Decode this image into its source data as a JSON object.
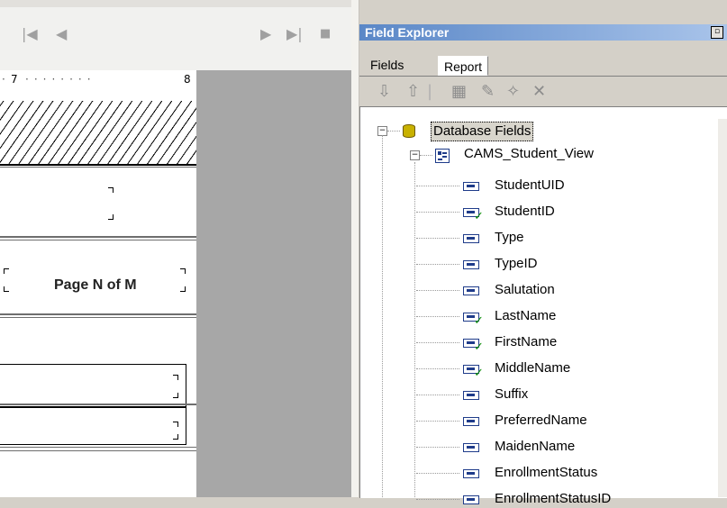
{
  "designer": {
    "nav_icons": [
      "first-page-icon",
      "prev-page-icon",
      "next-page-icon",
      "last-page-icon",
      "stop-icon"
    ],
    "ruler_start": "7",
    "ruler_end": "8",
    "page_label": "Page N of M"
  },
  "field_explorer": {
    "title": "Field Explorer",
    "tabs": [
      "Fields",
      "Report"
    ],
    "toolbar_icons": [
      "add-field-icon",
      "remove-field-icon",
      "new-table-icon",
      "edit-icon",
      "wand-icon",
      "delete-icon"
    ],
    "tree": {
      "root_label": "Database Fields",
      "view_label": "CAMS_Student_View",
      "fields": [
        {
          "name": "StudentUID",
          "checked": false
        },
        {
          "name": "StudentID",
          "checked": true
        },
        {
          "name": "Type",
          "checked": false
        },
        {
          "name": "TypeID",
          "checked": false
        },
        {
          "name": "Salutation",
          "checked": false
        },
        {
          "name": "LastName",
          "checked": true
        },
        {
          "name": "FirstName",
          "checked": true
        },
        {
          "name": "MiddleName",
          "checked": true
        },
        {
          "name": "Suffix",
          "checked": false
        },
        {
          "name": "PreferredName",
          "checked": false
        },
        {
          "name": "MaidenName",
          "checked": false
        },
        {
          "name": "EnrollmentStatus",
          "checked": false
        },
        {
          "name": "EnrollmentStatusID",
          "checked": false
        }
      ]
    }
  }
}
